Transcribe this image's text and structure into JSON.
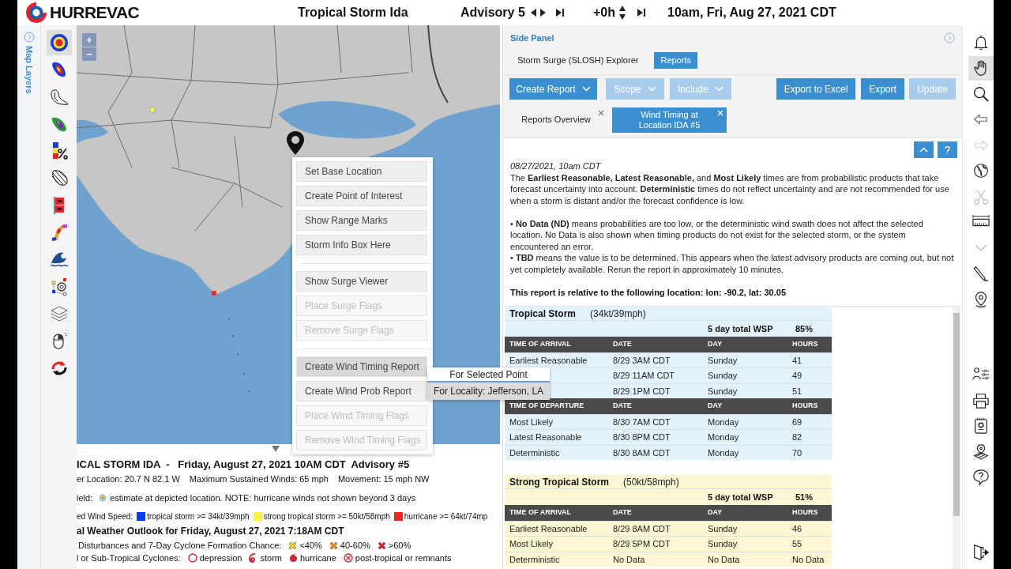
{
  "header": {
    "app_name": "HURREVAC",
    "storm": "Tropical Storm Ida",
    "advisory": "Advisory 5",
    "time_offset": "+0h",
    "datetime": "10am, Fri, Aug 27, 2021 CDT"
  },
  "map_layers_label": "Map Layers",
  "layer_tools": [
    {
      "selected": true
    },
    {
      "selected": false
    },
    {
      "selected": false
    },
    {
      "selected": false
    },
    {
      "selected": false
    },
    {
      "selected": false
    },
    {
      "selected": false
    },
    {
      "selected": false
    },
    {
      "selected": false
    },
    {
      "selected": false
    },
    {
      "selected": false
    },
    {
      "selected": false
    },
    {
      "selected": false
    }
  ],
  "map": {
    "zoom_in": "+",
    "zoom_out": "−"
  },
  "context_menu": {
    "items": [
      {
        "kind": "item",
        "label": "Set Base Location",
        "disabled": false,
        "selected": false
      },
      {
        "kind": "item",
        "label": "Create Point of Interest",
        "disabled": false,
        "selected": false
      },
      {
        "kind": "item",
        "label": "Show Range Marks",
        "disabled": false,
        "selected": false
      },
      {
        "kind": "item",
        "label": "Storm Info Box Here",
        "disabled": false,
        "selected": false
      },
      {
        "kind": "separator"
      },
      {
        "kind": "item",
        "label": "Show Surge Viewer",
        "disabled": false,
        "selected": false
      },
      {
        "kind": "item",
        "label": "Place Surge Flags",
        "disabled": true,
        "selected": false
      },
      {
        "kind": "item",
        "label": "Remove Surge Flags",
        "disabled": true,
        "selected": false
      },
      {
        "kind": "separator"
      },
      {
        "kind": "item",
        "label": "Create Wind Timing Report",
        "disabled": false,
        "selected": true
      },
      {
        "kind": "item",
        "label": "Create Wind Prob Report",
        "disabled": false,
        "selected": false
      },
      {
        "kind": "item",
        "label": "Place Wind Timing Flags",
        "disabled": true,
        "selected": false
      },
      {
        "kind": "item",
        "label": "Remove Wind Timing Flags",
        "disabled": true,
        "selected": false
      }
    ],
    "submenu": [
      {
        "label": "For Selected Point",
        "selected": false
      },
      {
        "label": "For Locality: Jefferson, LA",
        "selected": true
      }
    ]
  },
  "storm_info": {
    "title": "ICAL STORM IDA  -   Friday, August 27, 2021 10AM CDT  Advisory #5",
    "details": [
      "er Location: 20.7 N 82.1 W",
      "Maximum Sustained Winds: 65 mph",
      "Movement: 15 mph NW"
    ],
    "wind_field_label": "ield:",
    "wind_field_note": "estimate at depicted location. NOTE: hurricane winds not shown beyond 3 days",
    "wind_speed_label": "ed Wind Speed:",
    "wind_speed_legend": [
      {
        "label": "tropical storm >= 34kt/39mph",
        "color": "#0a3cf0"
      },
      {
        "label": "strong tropical storm >= 50kt/58mph",
        "color": "#f8f540"
      },
      {
        "label": "hurricane >= 64kt/74mp",
        "color": "#ea2a22"
      }
    ],
    "outlook_title": "al Weather Outlook for Friday, August 27, 2021 7:18AM CDT",
    "formation_label": "Disturbances and 7-Day Cyclone Formation Chance:",
    "formation_legend": [
      {
        "label": "<40%",
        "color": "#e6d23c"
      },
      {
        "label": "40-60%",
        "color": "#e0902e"
      },
      {
        "label": ">60%",
        "color": "#c8283a"
      }
    ],
    "cyclones_label": "l or Sub-Tropical Cyclones:",
    "cyclone_legend": [
      {
        "kind": "depression",
        "label": "depression"
      },
      {
        "kind": "storm",
        "label": "storm"
      },
      {
        "kind": "hurricane",
        "label": "hurricane"
      },
      {
        "kind": "post_tropical",
        "label": "post-tropical or remnants"
      }
    ]
  },
  "side_panel": {
    "title": "Side Panel",
    "tabs": [
      {
        "label": "Storm Surge (SLOSH) Explorer",
        "selected": false
      },
      {
        "label": "Reports",
        "selected": true
      }
    ],
    "toolbar": [
      {
        "label": "Create Report",
        "dropdown": true,
        "disabled": false
      },
      {
        "label": "Scope",
        "dropdown": true,
        "disabled": true
      },
      {
        "label": "Include",
        "dropdown": true,
        "disabled": true
      },
      {
        "label": "Export to Excel",
        "dropdown": false,
        "disabled": false
      },
      {
        "label": "Export",
        "dropdown": false,
        "disabled": false
      },
      {
        "label": "Update",
        "dropdown": false,
        "disabled": true
      }
    ],
    "report_tabs": [
      {
        "label": "Reports Overview",
        "selected": false
      },
      {
        "label": "Wind Timing at Location IDA #5",
        "selected": true
      }
    ],
    "report_date": "08/27/2021, 10am CDT",
    "paragraphs": [
      "The **Earliest Reasonable, Latest Reasonable,** and **Most Likely** times are from probabilistic products that take forecast uncertainty into account. **Deterministic** times do not reflect uncertainty and are not recommended for use when a storm is distant and/or the forecast confidence is low.",
      "• **No Data (ND)** means probabilities are too low, or the deterministic wind swath does not affect the selected location. No Data is also shown when timing products do not exist for the selected storm, or the system encountered an error.",
      "• **TBD** means the value is to be determined. This appears when the latest advisory products are coming out, but not yet completely available. Rerun the report in approximately 10 minutes."
    ],
    "location_note": "This report is relative to the following location: lon: -90.2, lat: 30.05",
    "sections": [
      {
        "title": "Tropical Storm",
        "speed": "(34kt/39mph)",
        "color": "#e4f3fb",
        "wsp_label": "5 day total WSP",
        "wsp_value": "85%",
        "groups": [
          {
            "columns": [
              "TIME OF ARRIVAL",
              "DATE",
              "DAY",
              "HOURS"
            ],
            "rows": [
              {
                "cells": [
                  "Earliest Reasonable",
                  "8/29 3AM CDT",
                  "Sunday",
                  "41"
                ]
              },
              {
                "cells": [
                  "",
                  "8/29 11AM CDT",
                  "Sunday",
                  "49"
                ]
              },
              {
                "cells": [
                  "",
                  "8/29 1PM CDT",
                  "Sunday",
                  "51"
                ]
              }
            ]
          },
          {
            "columns": [
              "TIME OF DEPARTURE",
              "DATE",
              "DAY",
              "HOURS"
            ],
            "rows": [
              {
                "cells": [
                  "Most Likely",
                  "8/30 7AM CDT",
                  "Monday",
                  "69"
                ]
              },
              {
                "cells": [
                  "Latest Reasonable",
                  "8/30 8PM CDT",
                  "Monday",
                  "82"
                ]
              },
              {
                "cells": [
                  "Deterministic",
                  "8/30 8AM CDT",
                  "Monday",
                  "70"
                ]
              }
            ]
          }
        ]
      },
      {
        "title": "Strong Tropical Storm",
        "speed": "(50kt/58mph)",
        "color": "#fdf6d2",
        "wsp_label": "5 day total WSP",
        "wsp_value": "51%",
        "groups": [
          {
            "columns": [
              "TIME OF ARRIVAL",
              "DATE",
              "DAY",
              "HOURS"
            ],
            "rows": [
              {
                "cells": [
                  "Earliest Reasonable",
                  "8/29 8AM CDT",
                  "Sunday",
                  "46"
                ]
              },
              {
                "cells": [
                  "Most Likely",
                  "8/29 5PM CDT",
                  "Sunday",
                  "55"
                ]
              },
              {
                "cells": [
                  "Deterministic",
                  "No Data",
                  "No Data",
                  "No Data"
                ]
              }
            ]
          }
        ]
      }
    ]
  },
  "right_tools_top": [
    {
      "selected": false,
      "disabled": false
    },
    {
      "selected": true,
      "disabled": false
    },
    {
      "selected": false,
      "disabled": false
    },
    {
      "selected": false,
      "disabled": false
    },
    {
      "selected": false,
      "disabled": true
    },
    {
      "selected": false,
      "disabled": false
    },
    {
      "selected": false,
      "disabled": true
    },
    {
      "selected": false,
      "disabled": false
    },
    {
      "selected": false,
      "disabled": true
    },
    {
      "selected": false,
      "disabled": false
    },
    {
      "selected": false,
      "disabled": false
    }
  ],
  "right_tools_middle": [
    {
      "selected": false,
      "disabled": false
    },
    {
      "selected": false,
      "disabled": false
    },
    {
      "selected": false,
      "disabled": false
    },
    {
      "selected": false,
      "disabled": false
    },
    {
      "selected": false,
      "disabled": false
    }
  ],
  "right_tools_bottom": [
    {
      "selected": false,
      "disabled": false
    }
  ]
}
